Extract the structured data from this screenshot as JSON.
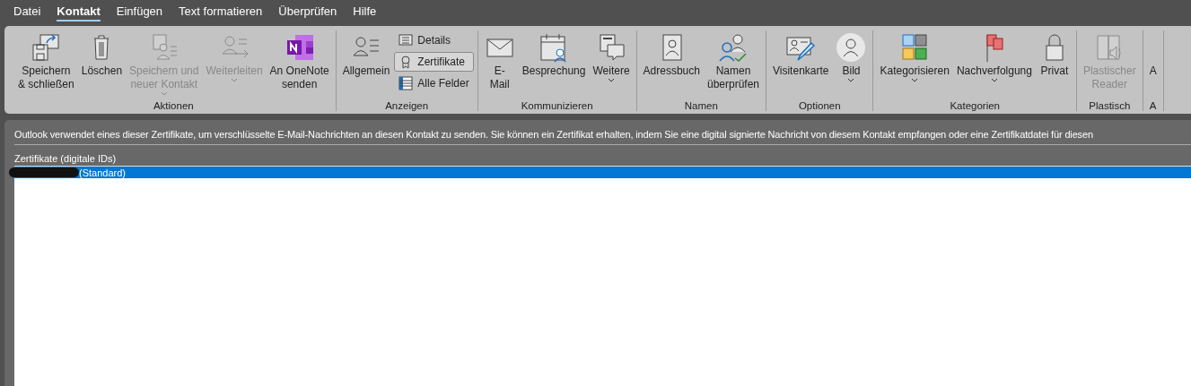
{
  "menu_tabs": [
    {
      "label": "Datei",
      "selected": false
    },
    {
      "label": "Kontakt",
      "selected": true
    },
    {
      "label": "Einfügen",
      "selected": false
    },
    {
      "label": "Text formatieren",
      "selected": false
    },
    {
      "label": "Überprüfen",
      "selected": false
    },
    {
      "label": "Hilfe",
      "selected": false
    }
  ],
  "ribbon_groups": [
    {
      "label": "Aktionen",
      "buttons": [
        {
          "kind": "large",
          "lines": [
            "Speichern",
            "& schließen"
          ],
          "disabled": false,
          "has_menu": false
        },
        {
          "kind": "large",
          "lines": [
            "Löschen"
          ],
          "disabled": false,
          "has_menu": false
        },
        {
          "kind": "large",
          "lines": [
            "Speichern und",
            "neuer Kontakt"
          ],
          "disabled": true,
          "has_menu": true
        },
        {
          "kind": "large",
          "lines": [
            "Weiterleiten"
          ],
          "disabled": true,
          "has_menu": true
        },
        {
          "kind": "large",
          "lines": [
            "An OneNote",
            "senden"
          ],
          "disabled": false,
          "has_menu": false
        }
      ]
    },
    {
      "label": "Anzeigen",
      "buttons": [
        {
          "kind": "large",
          "lines": [
            "Allgemein"
          ],
          "disabled": false,
          "has_menu": false
        },
        {
          "kind": "small",
          "lines": [
            "Details"
          ],
          "disabled": false,
          "selected": false
        },
        {
          "kind": "small",
          "lines": [
            "Zertifikate"
          ],
          "disabled": false,
          "selected": true
        },
        {
          "kind": "small",
          "lines": [
            "Alle Felder"
          ],
          "disabled": false,
          "selected": false
        }
      ]
    },
    {
      "label": "Kommunizieren",
      "buttons": [
        {
          "kind": "large",
          "lines": [
            "E-",
            "Mail"
          ],
          "disabled": false,
          "has_menu": false
        },
        {
          "kind": "large",
          "lines": [
            "Besprechung"
          ],
          "disabled": false,
          "has_menu": false
        },
        {
          "kind": "large",
          "lines": [
            "Weitere"
          ],
          "disabled": false,
          "has_menu": true
        }
      ]
    },
    {
      "label": "Namen",
      "buttons": [
        {
          "kind": "large",
          "lines": [
            "Adressbuch"
          ],
          "disabled": false,
          "has_menu": false
        },
        {
          "kind": "large",
          "lines": [
            "Namen",
            "überprüfen"
          ],
          "disabled": false,
          "has_menu": false
        }
      ]
    },
    {
      "label": "Optionen",
      "buttons": [
        {
          "kind": "large",
          "lines": [
            "Visitenkarte"
          ],
          "disabled": false,
          "has_menu": false
        },
        {
          "kind": "large",
          "lines": [
            "Bild"
          ],
          "disabled": false,
          "has_menu": true
        }
      ]
    },
    {
      "label": "Kategorien",
      "buttons": [
        {
          "kind": "large",
          "lines": [
            "Kategorisieren"
          ],
          "disabled": false,
          "has_menu": true
        },
        {
          "kind": "large",
          "lines": [
            "Nachverfolgung"
          ],
          "disabled": false,
          "has_menu": true
        },
        {
          "kind": "large",
          "lines": [
            "Privat"
          ],
          "disabled": false,
          "has_menu": false
        }
      ]
    },
    {
      "label": "Plastisch",
      "buttons": [
        {
          "kind": "large",
          "lines": [
            "Plastischer",
            "Reader"
          ],
          "disabled": true,
          "has_menu": false
        }
      ]
    },
    {
      "label": "A",
      "buttons": [
        {
          "kind": "large",
          "lines": [
            "A"
          ],
          "disabled": false,
          "has_menu": false
        }
      ]
    }
  ],
  "description": "Outlook verwendet eines dieser Zertifikate, um verschlüsselte E-Mail-Nachrichten an diesen Kontakt zu senden. Sie können ein Zertifikat erhalten, indem Sie eine digital signierte Nachricht von diesem Kontakt empfangen oder eine Zertifikatdatei für diesen",
  "certificates": {
    "label": "Zertifikate (digitale IDs)",
    "items": [
      {
        "text": "(Standard)",
        "selected": true,
        "redacted": true
      }
    ]
  }
}
